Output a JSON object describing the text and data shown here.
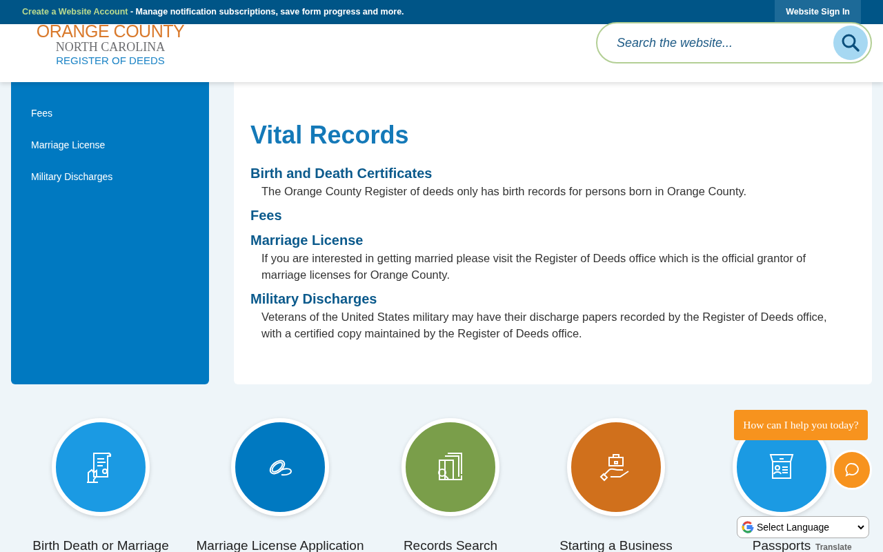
{
  "top_bar": {
    "link": "Create a Website Account",
    "message": " - Manage notification subscriptions, save form progress and more.",
    "sign_in": "Website Sign In"
  },
  "header": {
    "logo": {
      "line_1": "ORANGE COUNTY",
      "line_2": "NORTH CAROLINA",
      "line_3": "REGISTER OF DEEDS"
    },
    "search": {
      "placeholder": "Search the website..."
    }
  },
  "sidebar": {
    "items": [
      {
        "label": "Fees"
      },
      {
        "label": "Marriage License"
      },
      {
        "label": "Military Discharges"
      }
    ]
  },
  "page_title": "Vital Records",
  "sections": [
    {
      "heading": "Birth and Death Certificates",
      "text": "The Orange County Register of deeds only has birth records for persons born in Orange County."
    },
    {
      "heading": "Fees"
    },
    {
      "heading": "Marriage License",
      "text": "If you are interested in getting married please visit the Register of Deeds office which is the official grantor of marriage licenses for Orange County."
    },
    {
      "heading": "Military Discharges",
      "text": "Veterans of the United States military may have their discharge papers recorded by the Register of Deeds office, with a certified copy maintained by the Register of Deeds office."
    }
  ],
  "quick_links": [
    {
      "label": "Birth Death or Marriage",
      "color": "#1b9ae3"
    },
    {
      "label": "Marriage License Application",
      "color": "#0079c1"
    },
    {
      "label": "Records Search",
      "color": "#7a9e4a"
    },
    {
      "label": "Starting a Business",
      "color": "#d0701c"
    },
    {
      "label": "Passports",
      "color": "#1b9ae3"
    }
  ],
  "chat": {
    "prompt": "How can I help you today?"
  },
  "translate": {
    "select": "Select Language",
    "label": "Translate"
  }
}
